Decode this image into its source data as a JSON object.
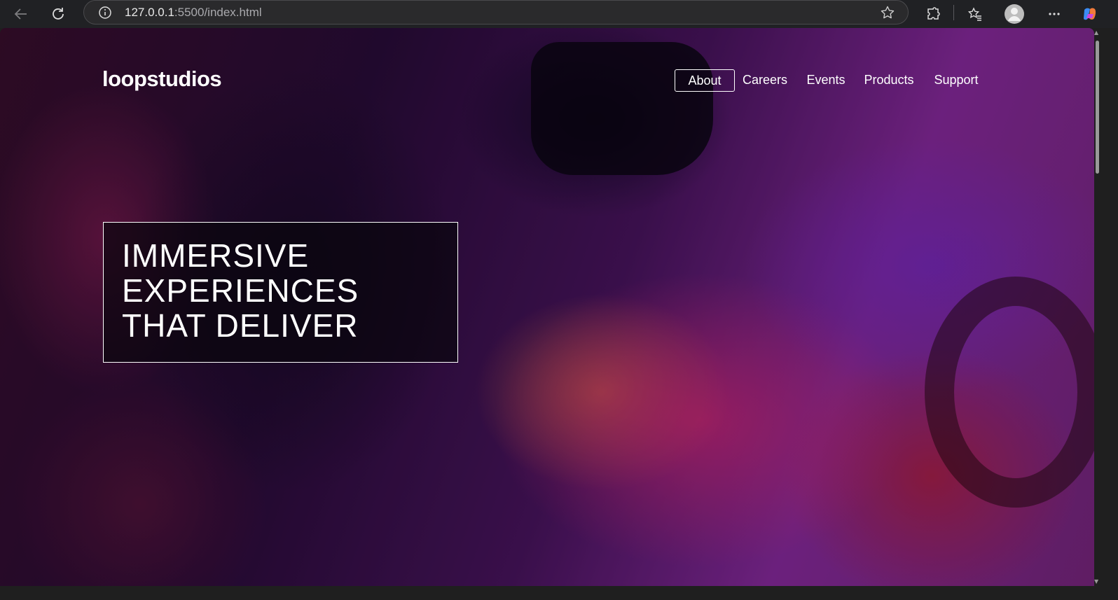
{
  "browser": {
    "url_host": "127.0.0.1",
    "url_rest": ":5500/index.html",
    "icons": {
      "back": "back-arrow-icon",
      "reload": "reload-icon",
      "info": "info-icon",
      "favorite": "star-icon",
      "extensions": "puzzle-icon",
      "favorites": "favorites-icon",
      "profile": "profile-icon",
      "menu": "more-icon",
      "copilot": "copilot-icon"
    }
  },
  "site": {
    "logo": "loopstudios",
    "nav": [
      {
        "label": "About",
        "active": true
      },
      {
        "label": "Careers",
        "active": false
      },
      {
        "label": "Events",
        "active": false
      },
      {
        "label": "Products",
        "active": false
      },
      {
        "label": "Support",
        "active": false
      }
    ],
    "hero_lines": [
      "IMMERSIVE",
      "EXPERIENCES",
      "THAT DELIVER"
    ]
  }
}
